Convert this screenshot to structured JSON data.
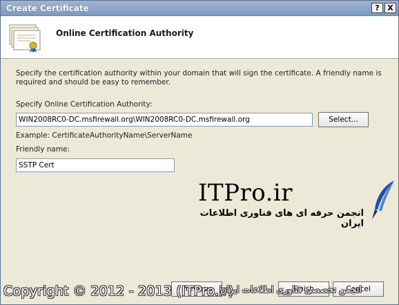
{
  "window": {
    "title": "Create Certificate",
    "help_glyph": "?",
    "close_glyph": "X"
  },
  "header": {
    "heading": "Online Certification Authority",
    "icon": "certificate-icon"
  },
  "form": {
    "description": "Specify the certification authority within your domain that will sign the certificate. A friendly name is required and should be easy to remember.",
    "ca_label": "Specify Online Certification Authority:",
    "ca_value": "WIN2008RC0-DC.msfirewall.org\\WIN2008RC0-DC.msfirewall.org",
    "select_button": "Select...",
    "example_text": "Example: CertificateAuthorityName\\ServerName",
    "friendly_label": "Friendly name:",
    "friendly_value": "SSTP Cert"
  },
  "footer": {
    "previous_button": "Previous",
    "finish_button": "Finish",
    "cancel_button": "Cancel"
  },
  "watermark": {
    "brand": "ITPro.ir",
    "farsi_tagline": "انجمن حرفه ای های فناوری اطلاعات ایران",
    "copyright": "Copyright © 2012 - 2013 (ITPro.ir)",
    "copyright_farsi": "انجمن تخصصی فناوری اطلاعات ایران"
  },
  "colors": {
    "titlebar": "#8aa3c8",
    "dialog_bg": "#ece9d8",
    "input_border": "#7f9db9"
  }
}
